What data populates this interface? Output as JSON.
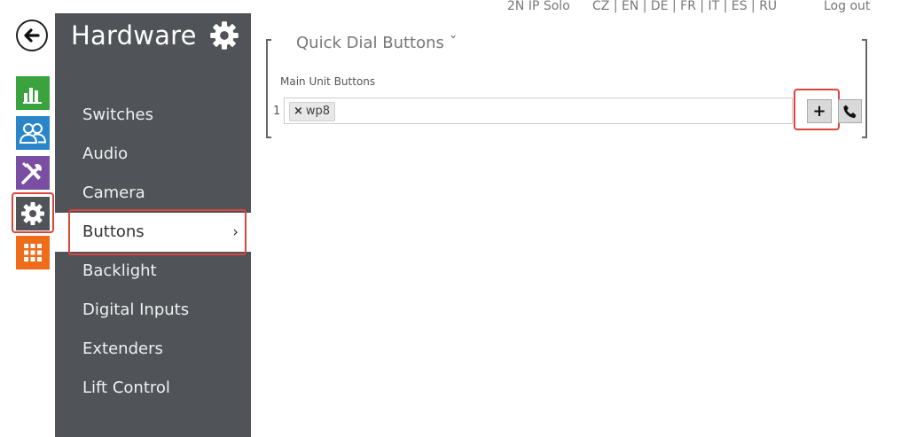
{
  "topbar": {
    "device": "2N IP Solo",
    "languages": "CZ | EN | DE | FR | IT | ES | RU",
    "logout": "Log out"
  },
  "rail": {
    "icons": [
      "back-arrow-icon",
      "statistics-icon",
      "directory-icon",
      "tools-icon",
      "gear-icon",
      "grid-icon"
    ],
    "colors": {
      "green": "#3aa33e",
      "blue": "#2a86c8",
      "purple": "#7a4fa3",
      "gray": "#505357",
      "orange": "#ef6c1a"
    }
  },
  "sidebar": {
    "title": "Hardware",
    "items": [
      {
        "label": "Switches"
      },
      {
        "label": "Audio"
      },
      {
        "label": "Camera"
      },
      {
        "label": "Buttons",
        "active": true
      },
      {
        "label": "Backlight"
      },
      {
        "label": "Digital Inputs"
      },
      {
        "label": "Extenders"
      },
      {
        "label": "Lift Control"
      }
    ],
    "active_chevron": "›"
  },
  "main": {
    "section_title": "Quick Dial Buttons ˇ",
    "field_label": "Main Unit Buttons",
    "row_number": "1",
    "tag_remove": "×",
    "tag_value": "wp8",
    "add_button": "+",
    "call_button_icon": "phone-icon"
  },
  "colors": {
    "highlight": "#d9453b",
    "sidebar_bg": "#505357"
  }
}
